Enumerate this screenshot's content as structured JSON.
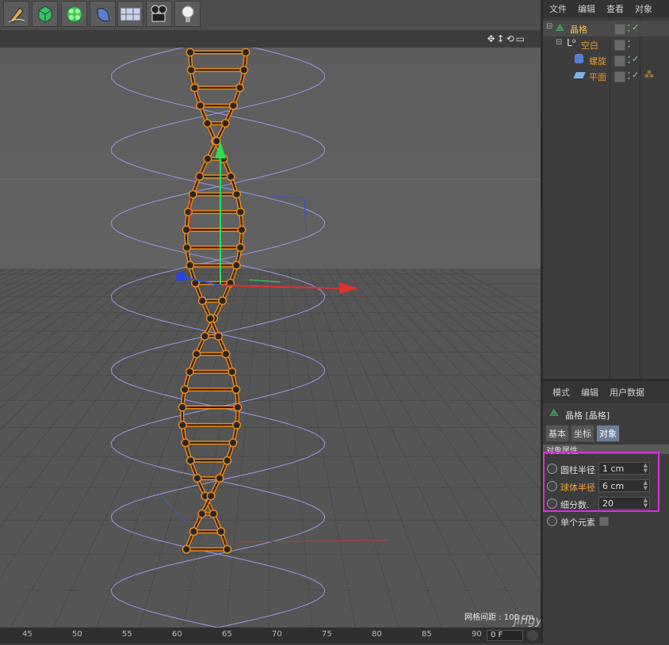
{
  "object_manager": {
    "menu": [
      "文件",
      "编辑",
      "查看",
      "对象"
    ],
    "objects": [
      {
        "name": "晶格",
        "color": "#e8b04a",
        "icon": "lattice-icon"
      },
      {
        "name": "空白",
        "color": "#e8b04a",
        "icon": "null-icon"
      },
      {
        "name": "螺旋",
        "color": "#e8b04a",
        "icon": "helix-icon"
      },
      {
        "name": "平面",
        "color": "#e8b04a",
        "icon": "plane-icon"
      }
    ]
  },
  "attribute_manager": {
    "menu": [
      "模式",
      "编辑",
      "用户数据"
    ],
    "title": "晶格 [晶格]",
    "tabs": [
      "基本",
      "坐标",
      "对象"
    ],
    "active_tab": "对象",
    "section_title": "对象属性",
    "params": [
      {
        "label": "圆柱半径",
        "value": "1 cm"
      },
      {
        "label": "球体半径",
        "value": "6 cm"
      },
      {
        "label": "细分数.",
        "value": "20"
      }
    ],
    "single_element_label": "单个元素"
  },
  "viewport": {
    "grid_spacing": "网格间距 : 100 cm",
    "watermark": "jingy"
  },
  "timeline": {
    "ticks": [
      "45",
      "50",
      "55",
      "60",
      "65",
      "70",
      "75",
      "80",
      "85",
      "90"
    ],
    "frame": "0 F"
  },
  "colors": {
    "highlight": "#d92fd9",
    "orange": "#e88a1e",
    "helix_wire": "#9b97e6"
  }
}
